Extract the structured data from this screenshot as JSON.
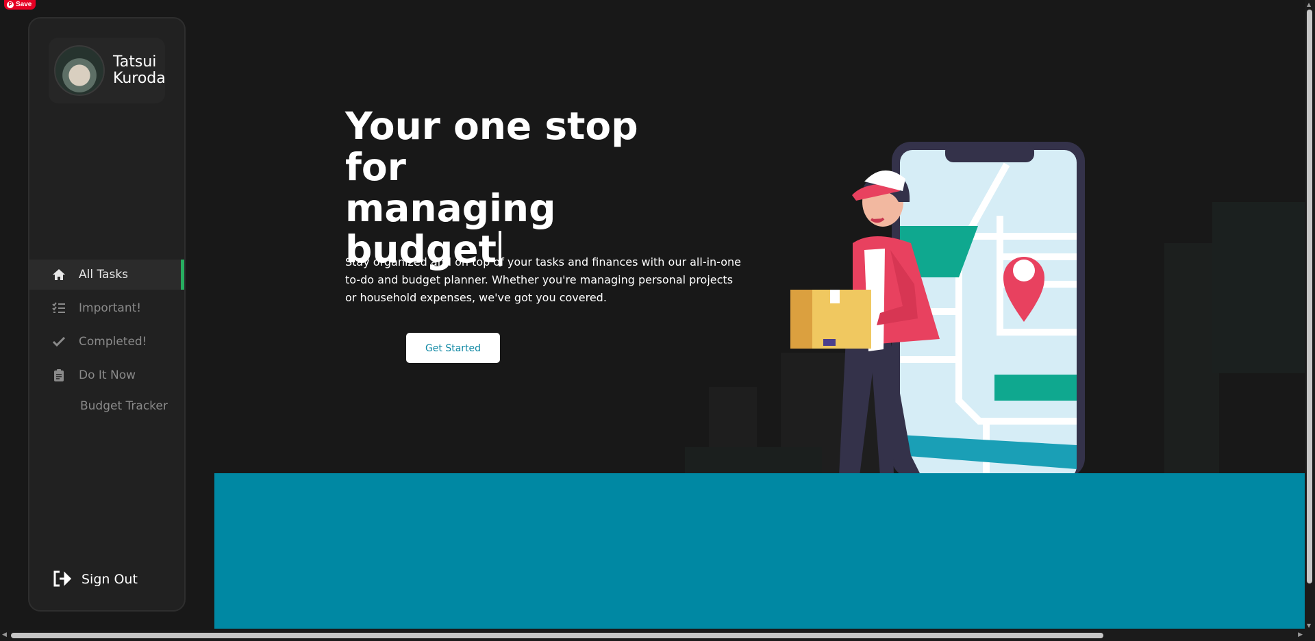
{
  "pinterest": {
    "save_label": "Save",
    "pin_glyph": "P"
  },
  "sidebar": {
    "user_name_line1": "Tatsui",
    "user_name_line2": "Kuroda",
    "items": [
      {
        "label": "All Tasks",
        "icon": "home-icon",
        "active": true
      },
      {
        "label": "Important!",
        "icon": "list-check-icon",
        "active": false
      },
      {
        "label": "Completed!",
        "icon": "check-icon",
        "active": false
      },
      {
        "label": "Do It Now",
        "icon": "clipboard-icon",
        "active": false
      },
      {
        "label": "Budget Tracker",
        "icon": "",
        "active": false
      }
    ],
    "sign_out_label": "Sign Out",
    "active_indicator_color": "#27ae60"
  },
  "hero": {
    "title_line1": "Your one stop for",
    "title_line2": "managing",
    "title_line3": "budget",
    "description": "Stay organized and on top of your tasks and finances with our all-in-one to-do and budget planner. Whether you're managing personal projects or household expenses, we've got you covered.",
    "cta_label": "Get Started"
  },
  "colors": {
    "background": "#181818",
    "sidebar": "#212121",
    "accent_band": "#0088a3",
    "cta_text": "#0f88a4",
    "pinterest_red": "#e60023"
  }
}
